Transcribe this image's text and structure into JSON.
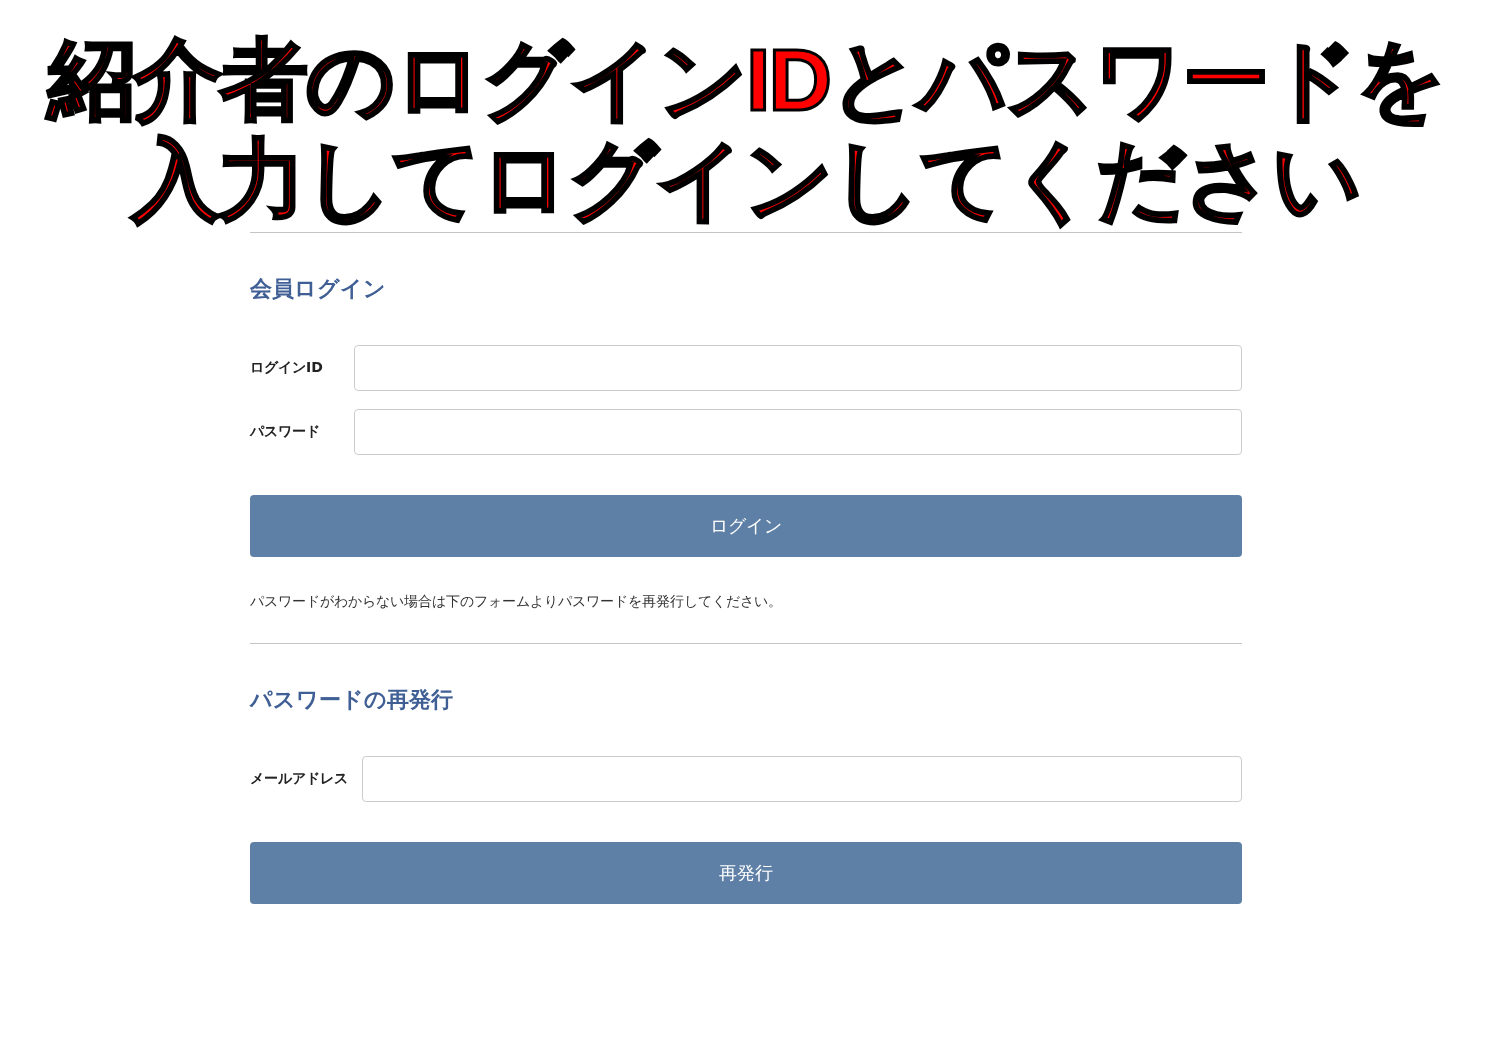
{
  "annotation": {
    "lines": [
      "紹介者のログインIDとパスワードを",
      "入力してログインしてください"
    ]
  },
  "sections": [
    {
      "heading": "会員ログイン",
      "fields": [
        {
          "label": "ログインID"
        },
        {
          "label": "パスワード"
        }
      ],
      "button": "ログイン",
      "note": "パスワードがわからない場合は下のフォームよりパスワードを再発行してください。"
    },
    {
      "heading": "パスワードの再発行",
      "fields": [
        {
          "label": "メールアドレス"
        }
      ],
      "button": "再発行"
    }
  ]
}
